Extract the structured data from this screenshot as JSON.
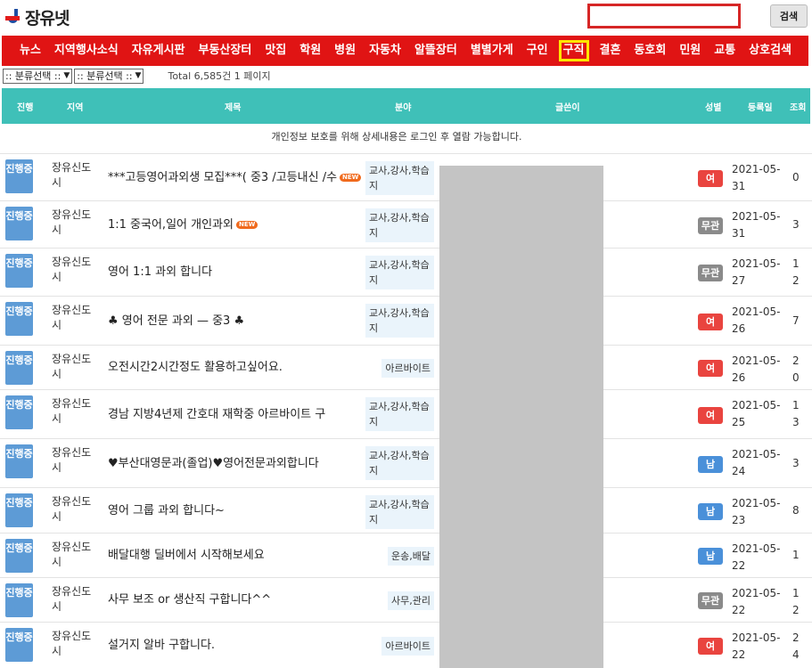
{
  "header": {
    "logo_text": "장유넷",
    "search_value": "",
    "search_button": "검색"
  },
  "nav": {
    "items": [
      "뉴스",
      "지역행사소식",
      "자유게시판",
      "부동산장터",
      "맛집",
      "학원",
      "병원",
      "자동차",
      "알뜰장터",
      "별별가게",
      "구인",
      "구직",
      "결혼",
      "동호회",
      "민원",
      "교통",
      "상호검색"
    ],
    "active": "구직"
  },
  "filters": {
    "select1": ":: 분류선택 ::",
    "select2": ":: 분류선택 ::",
    "total": "Total 6,585건 1 페이지"
  },
  "table": {
    "headers": {
      "status": "진행",
      "region": "지역",
      "title": "제목",
      "category": "분야",
      "author": "글쓴이",
      "gender": "성별",
      "date": "등록일",
      "views": "조회"
    },
    "notice": "개인정보 보호를 위해 상세내용은 로그인 후 열람 가능합니다.",
    "rows": [
      {
        "status": "진행중",
        "region": "장유신도시",
        "title": "***고등영어과외생 모집***( 중3 /고등내신 /수",
        "new": "NEW",
        "category": "교사,강사,학습지",
        "gender": "여",
        "date": "2021-05-31",
        "views": "0"
      },
      {
        "status": "진행중",
        "region": "장유신도시",
        "title": "1:1 중국어,일어 개인과외",
        "new": "NEW",
        "category": "교사,강사,학습지",
        "gender": "무관",
        "date": "2021-05-31",
        "views": "3"
      },
      {
        "status": "진행중",
        "region": "장유신도시",
        "title": "영어 1:1 과외 합니다",
        "new": "",
        "category": "교사,강사,학습지",
        "gender": "무관",
        "date": "2021-05-27",
        "views": "12"
      },
      {
        "status": "진행중",
        "region": "장유신도시",
        "title": "♣ 영어 전문 과외 — 중3 ♣",
        "new": "",
        "category": "교사,강사,학습지",
        "gender": "여",
        "date": "2021-05-26",
        "views": "7"
      },
      {
        "status": "진행중",
        "region": "장유신도시",
        "title": "오전시간2시간정도 활용하고싶어요.",
        "new": "",
        "category": "아르바이트",
        "gender": "여",
        "date": "2021-05-26",
        "views": "20"
      },
      {
        "status": "진행중",
        "region": "장유신도시",
        "title": "경남 지방4년제 간호대 재학중 아르바이트 구",
        "new": "",
        "category": "교사,강사,학습지",
        "gender": "여",
        "date": "2021-05-25",
        "views": "13"
      },
      {
        "status": "진행중",
        "region": "장유신도시",
        "title": "♥부산대영문과(졸업)♥영어전문과외합니다",
        "new": "",
        "category": "교사,강사,학습지",
        "gender": "남",
        "date": "2021-05-24",
        "views": "3"
      },
      {
        "status": "진행중",
        "region": "장유신도시",
        "title": "영어 그룹 과외 합니다~",
        "new": "",
        "category": "교사,강사,학습지",
        "gender": "남",
        "date": "2021-05-23",
        "views": "8"
      },
      {
        "status": "진행중",
        "region": "장유신도시",
        "title": "배달대행 딜버에서 시작해보세요",
        "new": "",
        "category": "운송,배달",
        "gender": "남",
        "date": "2021-05-22",
        "views": "1"
      },
      {
        "status": "진행중",
        "region": "장유신도시",
        "title": "사무 보조 or 생산직 구합니다^^",
        "new": "",
        "category": "사무,관리",
        "gender": "무관",
        "date": "2021-05-22",
        "views": "12"
      },
      {
        "status": "진행중",
        "region": "장유신도시",
        "title": "설거지 알바 구합니다.",
        "new": "",
        "category": "아르바이트",
        "gender": "여",
        "date": "2021-05-22",
        "views": "24"
      }
    ]
  }
}
